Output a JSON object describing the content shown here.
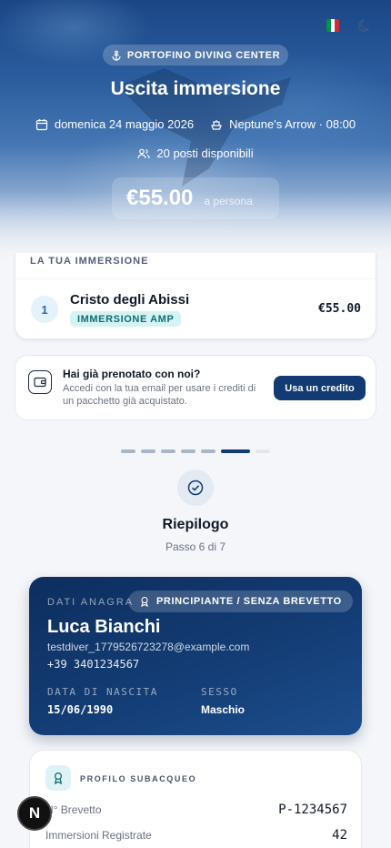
{
  "hero": {
    "center_name": "PORTOFINO DIVING CENTER",
    "title": "Uscita immersione",
    "date": "domenica 24 maggio 2026",
    "boat": "Neptune's Arrow · 08:00",
    "seats": "20 posti disponibili",
    "price": "€55.00",
    "price_unit": "a persona",
    "flag_colors": [
      "#009246",
      "#ffffff",
      "#ce2b37"
    ]
  },
  "dive": {
    "heading": "LA TUA IMMERSIONE",
    "index": "1",
    "name": "Cristo degli Abissi",
    "tag": "IMMERSIONE AMP",
    "price": "€55.00"
  },
  "credit": {
    "title": "Hai già prenotato con noi?",
    "text": "Accedi con la tua email per usare i crediti di un pacchetto già acquistato.",
    "button": "Usa un credito"
  },
  "progress": {
    "total_steps": 7,
    "current_step": 6,
    "title": "Riepilogo",
    "subtitle": "Passo 6 di 7"
  },
  "personal": {
    "label": "DATI ANAGRA",
    "level_chip": "PRINCIPIANTE / SENZA BREVETTO",
    "name": "Luca Bianchi",
    "email": "testdiver_1779526723278@example.com",
    "phone": "+39 3401234567",
    "dob_label": "DATA DI NASCITA",
    "dob": "15/06/1990",
    "sex_label": "SESSO",
    "sex": "Maschio"
  },
  "diver_profile": {
    "heading": "PROFILO SUBACQUEO",
    "rows": [
      {
        "label": "N° Brevetto",
        "value": "P-1234567"
      },
      {
        "label": "Immersioni Registrate",
        "value": "42"
      }
    ]
  },
  "fab": {
    "label": "N"
  },
  "colors": {
    "primary": "#123a73",
    "accent_teal": "#0f6d73"
  }
}
